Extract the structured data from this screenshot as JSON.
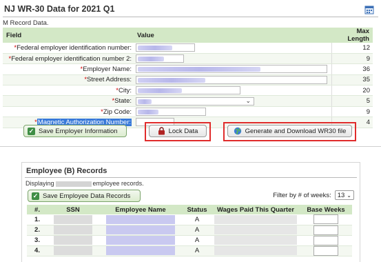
{
  "top": {
    "title": "NJ WR-30 Data for 2021 Q1",
    "subtitle": "M Record Data.",
    "headers": {
      "field": "Field",
      "value": "Value",
      "max": "Max Length"
    },
    "rows": [
      {
        "required": true,
        "label": "Federal employer identification number:",
        "max": "12"
      },
      {
        "required": true,
        "label": "Federal employer identification number 2:",
        "max": "9"
      },
      {
        "required": true,
        "label": "Employer Name:",
        "max": "36"
      },
      {
        "required": true,
        "label": "Street Address:",
        "max": "35"
      },
      {
        "required": true,
        "label": "City:",
        "max": "20"
      },
      {
        "required": true,
        "label": "State:",
        "max": "5"
      },
      {
        "required": true,
        "label": "Zip Code:",
        "max": "9"
      },
      {
        "required": true,
        "label": "Magnetic Authorization Number:",
        "max": "4"
      }
    ],
    "buttons": {
      "save": "Save Employer Information",
      "lock": "Lock Data",
      "generate": "Generate and Download WR30 file"
    }
  },
  "employees": {
    "title": "Employee (B) Records",
    "displaying_prefix": "Displaying",
    "displaying_suffix": "employee records.",
    "filter_label": "Filter by # of weeks:",
    "filter_value": "13",
    "save_button": "Save Employee Data Records",
    "columns": [
      "#.",
      "SSN",
      "Employee Name",
      "Status",
      "Wages Paid This Quarter",
      "Base Weeks"
    ],
    "rows": [
      {
        "num": "1.",
        "status": "A"
      },
      {
        "num": "2.",
        "status": "A"
      },
      {
        "num": "3.",
        "status": "A"
      },
      {
        "num": "4.",
        "status": "A"
      }
    ]
  },
  "colors": {
    "header_green": "#d3e8c6",
    "required_red": "#d40000",
    "highlight_red": "#e02b2b",
    "selection_blue": "#3879d9"
  }
}
